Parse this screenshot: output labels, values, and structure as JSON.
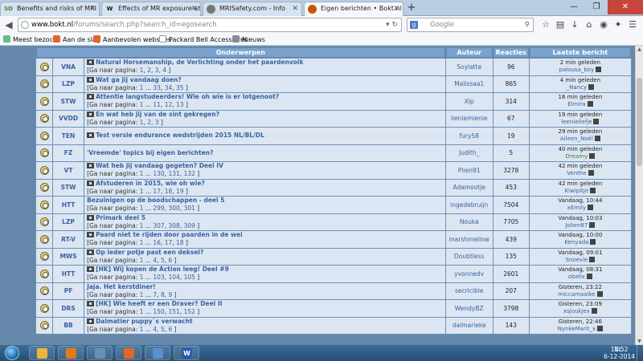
{
  "browser": {
    "tabs": [
      {
        "favicon": "SD",
        "favicon_color": "#3c8c3c",
        "title": "Benefits and risks of MRI in ..."
      },
      {
        "favicon": "W",
        "favicon_color": "#111111",
        "title": "Effects of MR exposure at 1..."
      },
      {
        "favicon": "",
        "favicon_color": "#777777",
        "title": "MRISafety.com - Info"
      },
      {
        "favicon": "",
        "favicon_color": "#cc5500",
        "title": "Eigen berichten • Bokt.nl"
      }
    ],
    "url_domain": "www.bokt.nl",
    "url_path": "/forums/search.php?search_id=egosearch",
    "search_placeholder": "Google",
    "bookmarks": [
      "Meest bezocht",
      "Aan de slag",
      "Aanbevolen websites",
      "Packard Bell Accessoires",
      "Nieuws"
    ]
  },
  "table": {
    "headers": {
      "topics": "Onderwerpen",
      "author": "Auteur",
      "replies": "Reacties",
      "last": "Laatste bericht"
    },
    "pages_prefix": "[Ga naar pagina: ",
    "rows": [
      {
        "cat": "VNA",
        "title": "Natural Horsemanship, de Verlichting onder het paardenvolk",
        "new": true,
        "pages": [
          "1",
          "2",
          "3",
          "4"
        ],
        "author": "Soylatte",
        "replies": "96",
        "time": "2 min geleden",
        "last_user": "palousa_boy"
      },
      {
        "cat": "LZP",
        "title": "Wat ga jij vandaag doen?",
        "new": true,
        "pages": [
          "1",
          "...",
          "33",
          "34",
          "35"
        ],
        "author": "Malissaa1",
        "replies": "865",
        "time": "4 min geleden",
        "last_user": "_Nancy"
      },
      {
        "cat": "STW",
        "title": "Attentie langstudeerders! Wie oh wie is er lotgenoot?",
        "new": true,
        "pages": [
          "1",
          "...",
          "11",
          "12",
          "13"
        ],
        "author": "Xip",
        "replies": "314",
        "time": "16 min geleden",
        "last_user": "Elmira"
      },
      {
        "cat": "VVDD",
        "title": "En wat heb jij van de sint gekregen?",
        "new": true,
        "pages": [
          "1",
          "2",
          "3"
        ],
        "author": "lieniemienie",
        "replies": "67",
        "time": "19 min geleden",
        "last_user": "leenieliefje"
      },
      {
        "cat": "TEN",
        "title": "Test versie endurance wedstrijden 2015 NL/BL/DL",
        "new": true,
        "pages": [],
        "author": "fury58",
        "replies": "19",
        "time": "29 min geleden",
        "last_user": "Aileen_Noël"
      },
      {
        "cat": "FZ",
        "title": "'Vreemde' topics bij eigen berichten?",
        "new": false,
        "pages": [],
        "author": "Judith_",
        "replies": "5",
        "time": "40 min geleden",
        "last_user": "Dreamy",
        "last_user_green": true
      },
      {
        "cat": "VT",
        "title": "Wat heb jij vandaag gegeten? Deel IV",
        "new": true,
        "pages": [
          "1",
          "...",
          "130",
          "131",
          "132"
        ],
        "author": "Plien91",
        "replies": "3278",
        "time": "42 min geleden",
        "last_user": "Venthe"
      },
      {
        "cat": "STW",
        "title": "Afstuderen in 2015, wie oh wie?",
        "new": true,
        "pages": [
          "1",
          "...",
          "17",
          "18",
          "19"
        ],
        "author": "Adamootje",
        "replies": "453",
        "time": "42 min geleden",
        "last_user": "Kiwipitje"
      },
      {
        "cat": "HTT",
        "title": "Bezuinigen op de boodschappen - deel 5",
        "new": false,
        "pages": [
          "1",
          "...",
          "299",
          "300",
          "301"
        ],
        "author": "ingedebruijn",
        "replies": "7504",
        "time": "Vandaag, 10:44",
        "last_user": "xEmily"
      },
      {
        "cat": "LZP",
        "title": "Primark deel 5",
        "new": true,
        "pages": [
          "1",
          "...",
          "307",
          "308",
          "309"
        ],
        "author": "Nouka",
        "replies": "7705",
        "time": "Vandaag, 10:03",
        "last_user": "Jolien87"
      },
      {
        "cat": "RT-V",
        "title": "Paard niet te rijden door paarden in de wei",
        "new": true,
        "pages": [
          "1",
          "...",
          "16",
          "17",
          "18"
        ],
        "author": "marshmellow",
        "replies": "439",
        "time": "Vandaag, 10:00",
        "last_user": "Kenyada"
      },
      {
        "cat": "MWS",
        "title": "Op ieder potje past een deksel?",
        "new": true,
        "pages": [
          "1",
          "...",
          "4",
          "5",
          "6"
        ],
        "author": "Doubtless",
        "replies": "135",
        "time": "Vandaag, 09:01",
        "last_user": "Snoevie"
      },
      {
        "cat": "HTT",
        "title": "[HK] Wij kopen de Action leeg! Deel #9",
        "new": true,
        "pages": [
          "1",
          "...",
          "103",
          "104",
          "105"
        ],
        "author": "yvonnedv",
        "replies": "2601",
        "time": "Vandaag, 08:31",
        "last_user": "obelix"
      },
      {
        "cat": "PF",
        "title": "Jaja. Het kerstdiner!",
        "new": false,
        "pages": [
          "1",
          "...",
          "7",
          "8",
          "9"
        ],
        "author": "secricible",
        "replies": "207",
        "time": "Gisteren, 23:22",
        "last_user": "miccamaaike"
      },
      {
        "cat": "DRS",
        "title": "[HK] Wie heeft er een Draver? Deel II",
        "new": true,
        "pages": [
          "1",
          "...",
          "150",
          "151",
          "152"
        ],
        "author": "WendyBZ",
        "replies": "3798",
        "time": "Gisteren, 23:09",
        "last_user": "xsjoukjex"
      },
      {
        "cat": "BB",
        "title": "Dalmatier puppy`s verwacht",
        "new": true,
        "pages": [
          "1",
          "...",
          "4",
          "5",
          "6"
        ],
        "author": "dalmarieke",
        "replies": "143",
        "time": "Gisteren, 22:46",
        "last_user": "NynkeMarit_x"
      }
    ]
  },
  "taskbar": {
    "apps": [
      {
        "icon": "explorer-icon",
        "color": "#e8b640"
      },
      {
        "icon": "media-player-icon",
        "color": "#e07a1a"
      },
      {
        "icon": "network-icon",
        "color": "#6a8fb5"
      },
      {
        "icon": "firefox-icon",
        "color": "#e0662a"
      },
      {
        "icon": "paint-icon",
        "color": "#5c8fd0"
      },
      {
        "icon": "word-icon",
        "color": "#2b5aa8",
        "label": "W"
      }
    ],
    "language": "NL",
    "time": "11:52",
    "date": "6-12-2014"
  }
}
